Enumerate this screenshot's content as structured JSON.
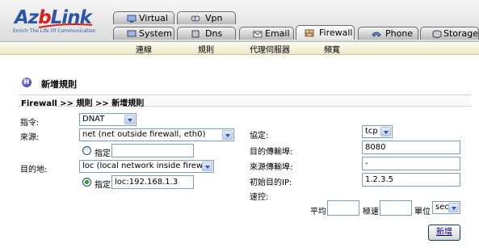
{
  "brand": {
    "name_part1": "Az",
    "name_part2": "b",
    "name_part3": "Link",
    "tagline": "Enrich The Life Of Communication"
  },
  "tabs_top": [
    {
      "label": "Virtual",
      "icon": "virtual-icon"
    },
    {
      "label": "Vpn",
      "icon": "vpn-icon"
    }
  ],
  "tabs_bottom": [
    {
      "label": "System",
      "icon": "system-icon"
    },
    {
      "label": "Dns",
      "icon": "dns-icon"
    },
    {
      "label": "Email",
      "icon": "email-icon"
    },
    {
      "label": "Firewall",
      "icon": "firewall-icon",
      "active": true
    },
    {
      "label": "Phone",
      "icon": "phone-icon"
    },
    {
      "label": "Storage",
      "icon": "storage-icon"
    }
  ],
  "submenu": [
    "連線",
    "規則",
    "代理伺服器",
    "頻寬"
  ],
  "page": {
    "title": "新增規則",
    "breadcrumb": "Firewall >> 規則 >> 新增規則"
  },
  "form": {
    "action_label": "指令:",
    "action_value": "DNAT",
    "source_label": "來源:",
    "source_value": "net (net outside firewall, eth0)",
    "source_specify_label": "指定",
    "source_specify_value": "",
    "dest_label": "目的地:",
    "dest_value": "loc (local network inside firewall)",
    "dest_specify_label": "指定",
    "dest_specify_value": "loc:192.168.1.3",
    "protocol_label": "協定:",
    "protocol_value": "tcp",
    "dest_port_label": "目的傳輸埠:",
    "dest_port_value": "8080",
    "source_port_label": "來源傳輸埠:",
    "source_port_value": "-",
    "orig_dest_ip_label": "初始目的IP:",
    "orig_dest_ip_value": "1.2.3.5",
    "rate_label": "速控:",
    "avg_label": "平均",
    "avg_value": "",
    "burst_label": "極速",
    "burst_value": "",
    "unit_label": "單位",
    "unit_value": "sec"
  },
  "submit_label": "新增",
  "colors": {
    "brand_blue": "#2b55a8",
    "brand_red": "#d4231d",
    "radio_green": "#21a121",
    "submenu_bg": "#f4f1dc"
  }
}
